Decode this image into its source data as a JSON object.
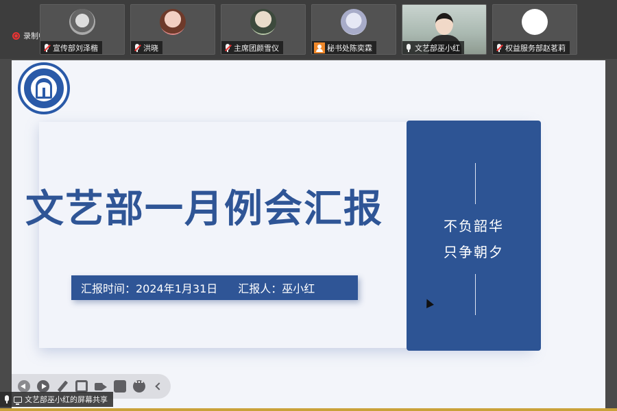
{
  "recording": {
    "label": "录制中",
    "color": "#e33333"
  },
  "participants": [
    {
      "name": "宣传部刘泽楷",
      "mic": "muted"
    },
    {
      "name": "洪晓",
      "mic": "muted"
    },
    {
      "name": "主席团颜雪仪",
      "mic": "muted"
    },
    {
      "name": "秘书处陈奕霖",
      "mic": "none",
      "badge": "person-icon"
    },
    {
      "name": "文艺部巫小红",
      "mic": "on",
      "video": true
    },
    {
      "name": "权益服务部赵茗莉",
      "mic": "muted"
    }
  ],
  "slide": {
    "title": "文艺部一月例会汇报",
    "report_time": "汇报时间：2024年1月31日",
    "reporter": "汇报人：巫小红",
    "motto_line1": "不负韶华",
    "motto_line2": "只争朝夕",
    "accent_color": "#2f5596"
  },
  "toolbar": {
    "icons": [
      "prev-icon",
      "play-icon",
      "pen-icon",
      "focus-icon",
      "camera-icon",
      "chat-icon",
      "more-icon",
      "collapse-icon"
    ]
  },
  "screen_share": {
    "label": "文艺部巫小红的屏幕共享"
  }
}
